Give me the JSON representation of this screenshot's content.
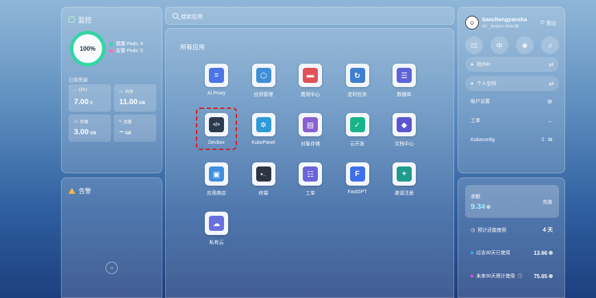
{
  "monitor": {
    "title": "监控",
    "gauge_percent": "100%",
    "healthy_pods": "健康 Pods: 4",
    "alert_pods": "告警 Pods: 0",
    "used_resources_label": "已用资源",
    "cpu": {
      "label": "CPU",
      "value": "7.00",
      "unit": "C"
    },
    "memory": {
      "label": "内存",
      "value": "11.00",
      "unit": "GB"
    },
    "storage": {
      "label": "存储",
      "value": "3.00",
      "unit": "GB"
    },
    "traffic": {
      "label": "流量",
      "value": "~",
      "unit": "GB"
    },
    "colors": {
      "healthy": "#33d6a3",
      "alert": "#ff6fae"
    }
  },
  "alert": {
    "title": "告警"
  },
  "search": {
    "placeholder": "搜索应用"
  },
  "apps": {
    "heading": "所有应用",
    "items": [
      {
        "name": "AI Proxy",
        "icon": "ai-proxy-icon",
        "color": "#4b74e6"
      },
      {
        "name": "应用管理",
        "icon": "app-manage-icon",
        "color": "#3f8fd8"
      },
      {
        "name": "费用中心",
        "icon": "cost-center-icon",
        "color": "#e0525a"
      },
      {
        "name": "定时任务",
        "icon": "cron-job-icon",
        "color": "#3f7fcf"
      },
      {
        "name": "数据库",
        "icon": "database-icon",
        "color": "#5d63d8"
      },
      {
        "name": "Devbox",
        "icon": "devbox-icon",
        "color": "#2a3b4f"
      },
      {
        "name": "KubePanel",
        "icon": "kubepanel-icon",
        "color": "#2e9ad8"
      },
      {
        "name": "对象存储",
        "icon": "object-storage-icon",
        "color": "#8a5fd0"
      },
      {
        "name": "云开发",
        "icon": "cloud-dev-icon",
        "color": "#17b48c"
      },
      {
        "name": "文档中心",
        "icon": "docs-center-icon",
        "color": "#5a56d0"
      },
      {
        "name": "应用商店",
        "icon": "app-store-icon",
        "color": "#3f8fe0"
      },
      {
        "name": "终端",
        "icon": "terminal-icon",
        "color": "#2d3542"
      },
      {
        "name": "工单",
        "icon": "ticket-icon",
        "color": "#6b64d8"
      },
      {
        "name": "FastGPT",
        "icon": "fastgpt-icon",
        "color": "#3f6fe8"
      },
      {
        "name": "邀请注册",
        "icon": "invite-icon",
        "color": "#1f9b8c"
      },
      {
        "name": "私有云",
        "icon": "private-cloud-icon",
        "color": "#6a6fe0"
      }
    ]
  },
  "profile": {
    "username": "banchengyansha",
    "user_id": "ID: _BxqVU7fsSu",
    "logout_label": "登出",
    "lang_button": "中",
    "region": "杭州H",
    "workspace": "个人空间",
    "account_settings": "账户设置",
    "ticket": "工单",
    "kubeconfig": "Kubeconfig"
  },
  "balance": {
    "label": "余额",
    "amount": "9.34",
    "recharge_label": "充值",
    "estimate_label": "预计还能使用",
    "estimate_value": "4 天",
    "past30_label": "过去30天已使用",
    "past30_value": "13.66",
    "next30_label": "未来30天预计使用",
    "next30_value": "75.65",
    "colors": {
      "past": "#3fa0ff",
      "next": "#d64fe0"
    }
  }
}
